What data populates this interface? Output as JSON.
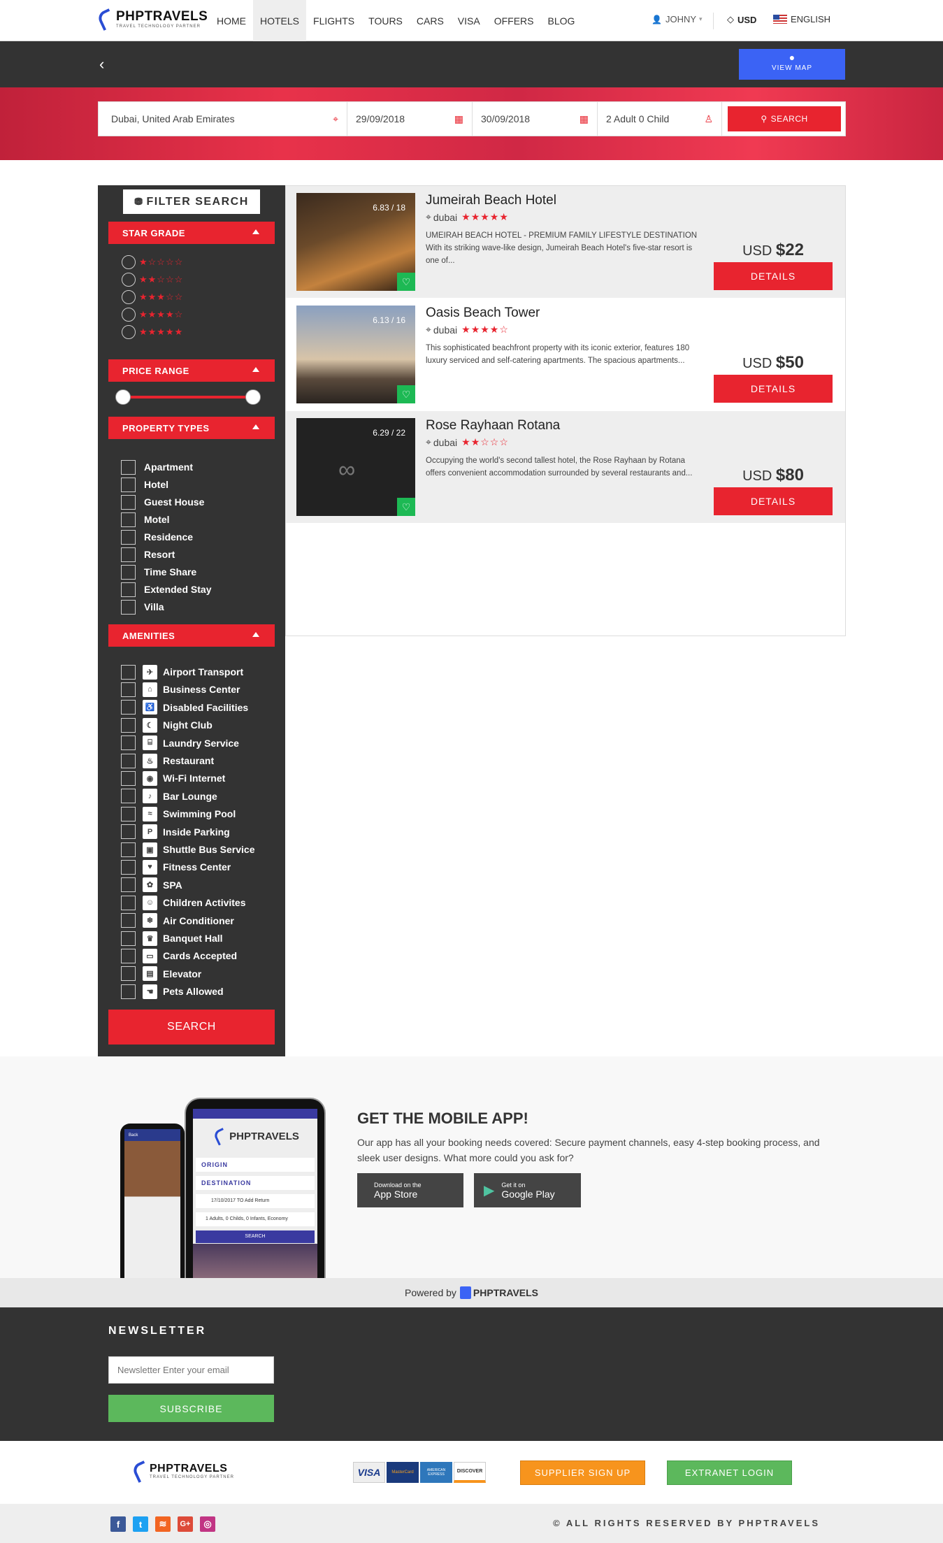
{
  "brand": {
    "name": "PHPTRAVELS",
    "tagline": "TRAVEL TECHNOLOGY PARTNER"
  },
  "nav": {
    "links": [
      "HOME",
      "HOTELS",
      "FLIGHTS",
      "TOURS",
      "CARS",
      "VISA",
      "OFFERS",
      "BLOG"
    ],
    "active": "HOTELS",
    "user": "JOHNY",
    "currency": "USD",
    "language": "ENGLISH"
  },
  "subbar": {
    "view_map": "VIEW MAP",
    "back_icon": "chevron-left-icon"
  },
  "search": {
    "location": "Dubai, United Arab Emirates",
    "checkin": "29/09/2018",
    "checkout": "30/09/2018",
    "guests": "2 Adult 0 Child",
    "button": "SEARCH"
  },
  "filter": {
    "title": "FILTER SEARCH",
    "star_grade": {
      "heading": "STAR GRADE",
      "options": [
        1,
        2,
        3,
        4,
        5
      ]
    },
    "price_range": {
      "heading": "PRICE RANGE",
      "min_fraction": 0,
      "max_fraction": 1
    },
    "property_types": {
      "heading": "PROPERTY TYPES",
      "items": [
        "Apartment",
        "Hotel",
        "Guest House",
        "Motel",
        "Residence",
        "Resort",
        "Time Share",
        "Extended Stay",
        "Villa"
      ]
    },
    "amenities": {
      "heading": "AMENITIES",
      "items": [
        "Airport Transport",
        "Business Center",
        "Disabled Facilities",
        "Night Club",
        "Laundry Service",
        "Restaurant",
        "Wi-Fi Internet",
        "Bar Lounge",
        "Swimming Pool",
        "Inside Parking",
        "Shuttle Bus Service",
        "Fitness Center",
        "SPA",
        "Children Activites",
        "Air Conditioner",
        "Banquet Hall",
        "Cards Accepted",
        "Elevator",
        "Pets Allowed"
      ]
    },
    "search_button": "SEARCH"
  },
  "hotels": [
    {
      "name": "Jumeirah Beach Hotel",
      "location": "dubai",
      "stars": 5,
      "rating": "6.83 / 18",
      "description": "UMEIRAH BEACH HOTEL - PREMIUM FAMILY LIFESTYLE DESTINATION With its striking wave-like design, Jumeirah Beach Hotel's five-star resort is one of...",
      "currency": "USD",
      "price": "$22",
      "button": "DETAILS"
    },
    {
      "name": "Oasis Beach Tower",
      "location": "dubai",
      "stars": 4,
      "rating": "6.13 / 16",
      "description": "This sophisticated beachfront property with its iconic exterior, features 180 luxury serviced and self-catering apartments. The spacious apartments...",
      "currency": "USD",
      "price": "$50",
      "button": "DETAILS"
    },
    {
      "name": "Rose Rayhaan Rotana",
      "location": "dubai",
      "stars": 2,
      "rating": "6.29 / 22",
      "description": "Occupying the world's second tallest hotel, the Rose Rayhaan by Rotana offers convenient accommodation surrounded by several restaurants and...",
      "currency": "USD",
      "price": "$80",
      "button": "DETAILS"
    }
  ],
  "app": {
    "heading": "GET THE MOBILE APP!",
    "text": "Our app has all your booking needs covered: Secure payment channels, easy 4-step booking process, and sleek user designs. What more could you ask for?",
    "appstore_small": "Download on the",
    "appstore_big": "App Store",
    "play_small": "Get it on",
    "play_big": "Google Play",
    "phone": {
      "origin": "ORIGIN",
      "destination": "DESTINATION",
      "date": "17/10/2017  TO  Add Return",
      "guests": "1 Adults, 0 Childs, 0 Infants, Economy",
      "search": "SEARCH",
      "back": "Back"
    }
  },
  "powered": {
    "label": "Powered by",
    "brand": "PHPTRAVELS"
  },
  "newsletter": {
    "heading": "NEWSLETTER",
    "placeholder": "Newsletter Enter your email",
    "button": "SUBSCRIBE"
  },
  "footer": {
    "cards": [
      "VISA",
      "MasterCard",
      "AMERICAN EXPRESS",
      "DISCOVER"
    ],
    "supplier": "SUPPLIER SIGN UP",
    "extranet": "EXTRANET LOGIN",
    "copyright": "© ALL RIGHTS RESERVED BY PHPTRAVELS",
    "social": [
      "facebook-icon",
      "twitter-icon",
      "rss-icon",
      "google-plus-icon",
      "instagram-icon"
    ]
  },
  "colors": {
    "accent": "#e8242f",
    "dark": "#333333",
    "blue": "#3b63f5",
    "green": "#5cb85c",
    "orange": "#f7941d"
  }
}
